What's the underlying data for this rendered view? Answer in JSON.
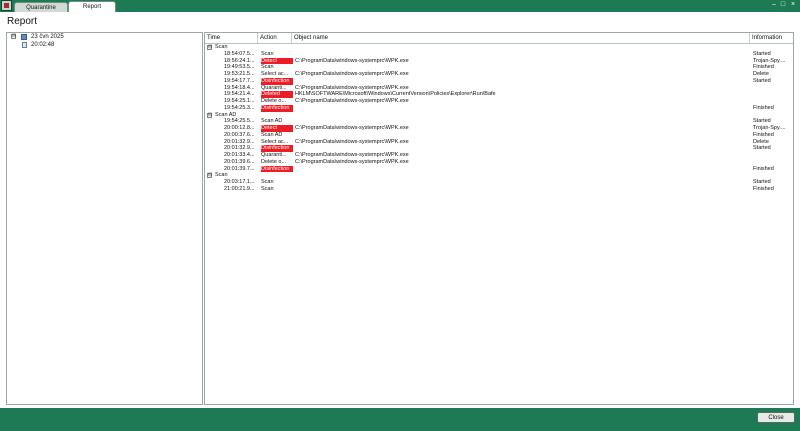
{
  "window": {
    "tabs": [
      {
        "label": "Quarantine"
      },
      {
        "label": "Report"
      }
    ],
    "controls": {
      "minimize": "–",
      "maximize": "□",
      "close": "×"
    }
  },
  "page": {
    "title": "Report"
  },
  "tree": {
    "date_node": {
      "label": "23 čvn 2025",
      "expander": "⊟"
    },
    "time_node": {
      "label": "20:02:48"
    }
  },
  "table": {
    "columns": [
      "Time",
      "Action",
      "Object name",
      "Information"
    ],
    "rows": [
      {
        "type": "group",
        "label": "Scan",
        "expander": "⊟"
      },
      {
        "time": "18:54:07.5...",
        "action": "Scan",
        "highlight": false,
        "object": "",
        "info": "Started"
      },
      {
        "time": "18:56:24.1...",
        "action": "Detect",
        "highlight": true,
        "object": "C:\\ProgramData\\windows-systemprc\\WPK.exe",
        "info": "Trojan-Spy...."
      },
      {
        "time": "19:49:53.5...",
        "action": "Scan",
        "highlight": false,
        "object": "",
        "info": "Finished"
      },
      {
        "time": "19:53:21.5...",
        "action": "Select ac...",
        "highlight": false,
        "object": "C:\\ProgramData\\windows-systemprc\\WPK.exe",
        "info": "Delete"
      },
      {
        "time": "19:54:17.7...",
        "action": "Disinfection",
        "highlight": true,
        "object": "",
        "info": "Started"
      },
      {
        "time": "19:54:18.4...",
        "action": "Quaranti...",
        "highlight": false,
        "object": "C:\\ProgramData\\windows-systemprc\\WPK.exe",
        "info": ""
      },
      {
        "time": "19:54:21.4...",
        "action": "Deleted",
        "highlight": true,
        "object": "HKLM\\SOFTWARE\\Microsoft\\Windows\\CurrentVersion\\Policies\\Explorer\\Run\\Bafe",
        "info": ""
      },
      {
        "time": "19:54:25.1...",
        "action": "Delete o...",
        "highlight": false,
        "object": "C:\\ProgramData\\windows-systemprc\\WPK.exe",
        "info": ""
      },
      {
        "time": "19:54:25.3...",
        "action": "Disinfection",
        "highlight": true,
        "object": "",
        "info": "Finished"
      },
      {
        "type": "group",
        "label": "Scan AD",
        "expander": "⊟"
      },
      {
        "time": "19:54:25.5...",
        "action": "Scan AD",
        "highlight": false,
        "object": "",
        "info": "Started"
      },
      {
        "time": "20:00:12.8...",
        "action": "Detect",
        "highlight": true,
        "object": "C:\\ProgramData\\windows-systemprc\\WPK.exe",
        "info": "Trojan-Spy...."
      },
      {
        "time": "20:00:37.6...",
        "action": "Scan AD",
        "highlight": false,
        "object": "",
        "info": "Finished"
      },
      {
        "time": "20:01:32.9...",
        "action": "Select ac...",
        "highlight": false,
        "object": "C:\\ProgramData\\windows-systemprc\\WPK.exe",
        "info": "Delete"
      },
      {
        "time": "20:01:32.9...",
        "action": "Disinfection",
        "highlight": true,
        "object": "",
        "info": "Started"
      },
      {
        "time": "20:01:33.4...",
        "action": "Quaranti...",
        "highlight": false,
        "object": "C:\\ProgramData\\windows-systemprc\\WPK.exe",
        "info": ""
      },
      {
        "time": "20:01:39.6...",
        "action": "Delete o...",
        "highlight": false,
        "object": "C:\\ProgramData\\windows-systemprc\\WPK.exe",
        "info": ""
      },
      {
        "time": "20:01:39.7...",
        "action": "Disinfection",
        "highlight": true,
        "object": "",
        "info": "Finished"
      },
      {
        "type": "group",
        "label": "Scan",
        "expander": "⊟"
      },
      {
        "time": "20:03:17.1...",
        "action": "Scan",
        "highlight": false,
        "object": "",
        "info": "Started"
      },
      {
        "time": "21:00:21.9...",
        "action": "Scan",
        "highlight": false,
        "object": "",
        "info": "Finished"
      }
    ]
  },
  "footer": {
    "close_label": "Close"
  },
  "colors": {
    "frame": "#1d7a55",
    "highlight": "#ee1d25"
  }
}
